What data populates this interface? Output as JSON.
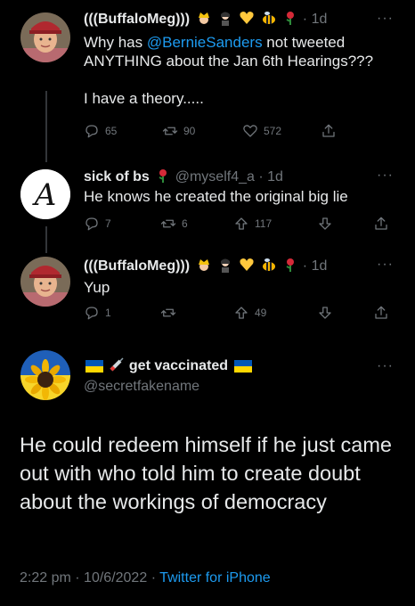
{
  "tweets": [
    {
      "name": "(((BuffaloMeg)))",
      "time": "1d",
      "emojis": [
        "princess-emoji",
        "person-emoji",
        "yellow-heart-emoji",
        "bee-emoji",
        "rose-emoji"
      ],
      "text_prefix": "Why has ",
      "mention": "@BernieSanders",
      "text_suffix": " not tweeted\nANYTHING about the Jan 6th Hearings???\n\nI have a theory.....",
      "replies": "65",
      "retweets": "90",
      "likes": "572"
    },
    {
      "name": "sick of bs",
      "handle": "@myself4_a",
      "time": "1d",
      "emojis": [
        "rose-emoji"
      ],
      "text": "He knows he created the original big lie",
      "replies": "7",
      "retweets": "6",
      "upvotes": "117"
    },
    {
      "name": "(((BuffaloMeg)))",
      "time": "1d",
      "emojis": [
        "princess-emoji",
        "person-emoji",
        "yellow-heart-emoji",
        "bee-emoji",
        "rose-emoji"
      ],
      "text": "Yup",
      "replies": "1",
      "retweets": "",
      "upvotes": "49"
    }
  ],
  "main": {
    "name": "get vaccinated",
    "handle": "@secretfakename",
    "text": "He could redeem himself if he just came out with who told him to create doubt about the workings of democracy",
    "time": "2:22 pm",
    "date": "10/6/2022",
    "source": "Twitter for iPhone"
  },
  "separator": "·",
  "more_label": "···",
  "colors": {
    "accent": "#1d9bf0",
    "muted": "#71767b",
    "text": "#e7e9ea",
    "background": "#000000"
  }
}
